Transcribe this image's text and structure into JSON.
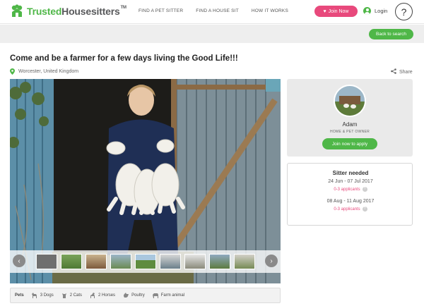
{
  "header": {
    "logo_part1": "Trusted",
    "logo_part2": "Housesitters",
    "logo_tm": "TM",
    "nav": [
      "FIND A PET SITTER",
      "FIND A HOUSE SIT",
      "HOW IT WORKS"
    ],
    "join_label": "Join Now",
    "login_label": "Login",
    "help_label": "?"
  },
  "subbar": {
    "back_label": "Back to search"
  },
  "listing": {
    "title": "Come and be a farmer for a few days living the Good Life!!!",
    "location": "Worcester, United Kingdom",
    "share_label": "Share"
  },
  "gallery": {
    "prev_label": "‹",
    "next_label": "›",
    "thumbnail_count": 9
  },
  "pets": {
    "label": "Pets",
    "items": [
      "3 Dogs",
      "2 Cats",
      "2 Horses",
      "Poultry",
      "Farm animal"
    ]
  },
  "owner": {
    "name": "Adam",
    "role": "HOME & PET OWNER",
    "apply_label": "Join now to apply"
  },
  "sitter_needed": {
    "title": "Sitter needed",
    "slots": [
      {
        "dates": "24 Jun - 07 Jul 2017",
        "applicants": "0-3 applicants"
      },
      {
        "dates": "08 Aug - 11 Aug 2017",
        "applicants": "0-3 applicants"
      }
    ]
  },
  "colors": {
    "brand_green": "#4fb748",
    "brand_pink": "#e8497c"
  }
}
